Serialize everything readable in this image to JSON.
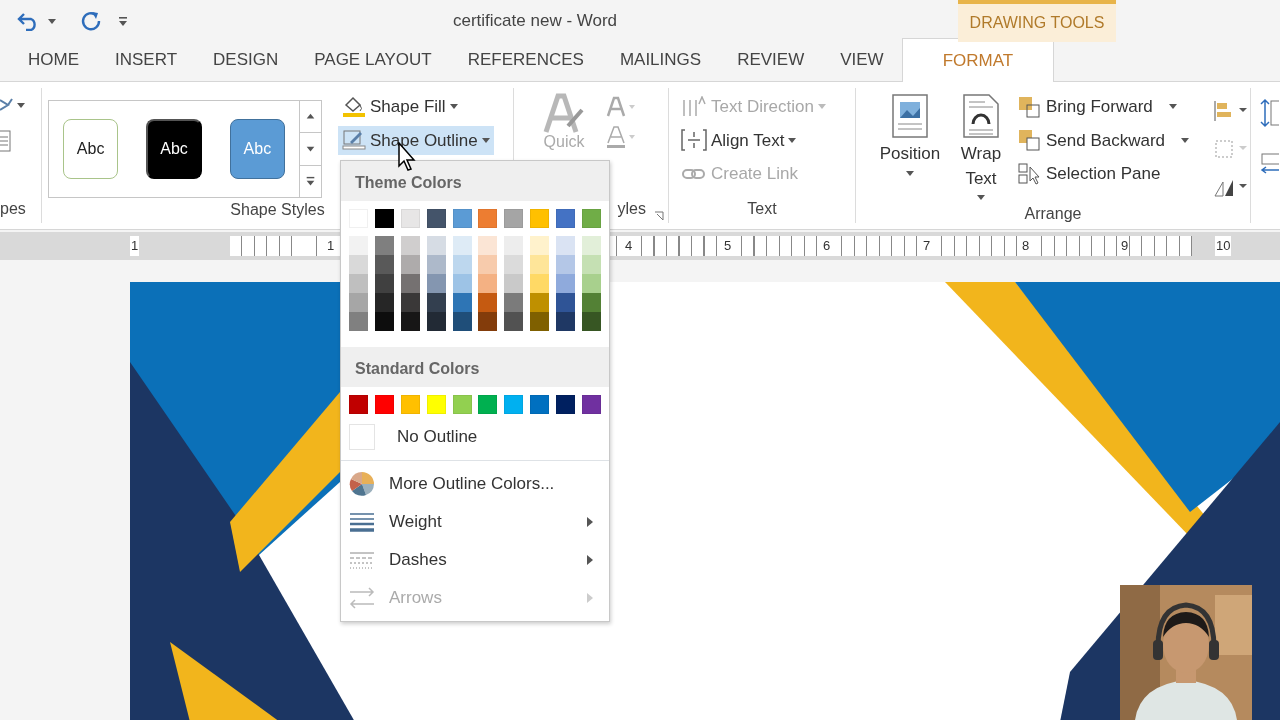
{
  "window": {
    "title": "certificate new - Word"
  },
  "context_tab_group": {
    "label": "DRAWING TOOLS"
  },
  "tabs": [
    {
      "label": "HOME",
      "selected": false
    },
    {
      "label": "INSERT",
      "selected": false
    },
    {
      "label": "DESIGN",
      "selected": false
    },
    {
      "label": "PAGE LAYOUT",
      "selected": false
    },
    {
      "label": "REFERENCES",
      "selected": false
    },
    {
      "label": "MAILINGS",
      "selected": false
    },
    {
      "label": "REVIEW",
      "selected": false
    },
    {
      "label": "VIEW",
      "selected": false
    },
    {
      "label": "FORMAT",
      "selected": true
    }
  ],
  "ribbon": {
    "shapes_group": {
      "label": "pes"
    },
    "shape_styles": {
      "label": "Shape Styles",
      "presets": [
        {
          "label": "Abc",
          "kind": "outline"
        },
        {
          "label": "Abc",
          "kind": "dark"
        },
        {
          "label": "Abc",
          "kind": "accent"
        }
      ],
      "commands": [
        {
          "label": "Shape Fill",
          "kind": "fill",
          "selected": false
        },
        {
          "label": "Shape Outline",
          "kind": "outline",
          "selected": true
        }
      ]
    },
    "wordart_styles": {
      "button_label": "Quick",
      "label": "yles"
    },
    "text_group": {
      "label": "Text",
      "commands": [
        {
          "label": "Text Direction",
          "kind": "direction",
          "disabled": true
        },
        {
          "label": "Align Text",
          "kind": "align",
          "disabled": false
        },
        {
          "label": "Create Link",
          "kind": "link",
          "disabled": true
        }
      ]
    },
    "arrange": {
      "label": "Arrange",
      "large": [
        {
          "label": "Position",
          "kind": "position"
        },
        {
          "label": "Wrap Text",
          "kind": "wrap"
        }
      ],
      "commands": [
        {
          "label": "Bring Forward",
          "kind": "forward"
        },
        {
          "label": "Send Backward",
          "kind": "backward"
        },
        {
          "label": "Selection Pane",
          "kind": "pane"
        }
      ]
    }
  },
  "ruler": {
    "labels": [
      "1",
      "1",
      "4",
      "5",
      "6",
      "7",
      "8",
      "9",
      "10"
    ]
  },
  "outline_menu": {
    "theme_heading": "Theme Colors",
    "theme_colors": [
      {
        "color": "#ffffff",
        "shades": [
          {
            "color": "#f2f2f2"
          },
          {
            "color": "#d9d9d9"
          },
          {
            "color": "#bfbfbf"
          },
          {
            "color": "#a6a6a6"
          },
          {
            "color": "#808080"
          }
        ]
      },
      {
        "color": "#000000",
        "shades": [
          {
            "color": "#7f7f7f"
          },
          {
            "color": "#595959"
          },
          {
            "color": "#404040"
          },
          {
            "color": "#262626"
          },
          {
            "color": "#0d0d0d"
          }
        ]
      },
      {
        "color": "#e7e6e6",
        "shades": [
          {
            "color": "#d0cece"
          },
          {
            "color": "#aeabab"
          },
          {
            "color": "#757171"
          },
          {
            "color": "#3a3838"
          },
          {
            "color": "#171616"
          }
        ]
      },
      {
        "color": "#44546a",
        "shades": [
          {
            "color": "#d6dce4"
          },
          {
            "color": "#adb9ca"
          },
          {
            "color": "#8496b0"
          },
          {
            "color": "#333f4f"
          },
          {
            "color": "#222a35"
          }
        ]
      },
      {
        "color": "#5b9bd5",
        "shades": [
          {
            "color": "#deebf6"
          },
          {
            "color": "#bdd7ee"
          },
          {
            "color": "#9dc3e6"
          },
          {
            "color": "#2e75b5"
          },
          {
            "color": "#1f4e79"
          }
        ]
      },
      {
        "color": "#ed7d31",
        "shades": [
          {
            "color": "#fbe5d5"
          },
          {
            "color": "#f7cbac"
          },
          {
            "color": "#f4b183"
          },
          {
            "color": "#c55a11"
          },
          {
            "color": "#833c0b"
          }
        ]
      },
      {
        "color": "#a5a5a5",
        "shades": [
          {
            "color": "#ededed"
          },
          {
            "color": "#dbdbdb"
          },
          {
            "color": "#c9c9c9"
          },
          {
            "color": "#7b7b7b"
          },
          {
            "color": "#525252"
          }
        ]
      },
      {
        "color": "#ffc000",
        "shades": [
          {
            "color": "#fff2cc"
          },
          {
            "color": "#fee599"
          },
          {
            "color": "#ffd965"
          },
          {
            "color": "#bf9000"
          },
          {
            "color": "#7f6000"
          }
        ]
      },
      {
        "color": "#4472c4",
        "shades": [
          {
            "color": "#dae3f3"
          },
          {
            "color": "#b4c7e7"
          },
          {
            "color": "#8faadc"
          },
          {
            "color": "#2f5496"
          },
          {
            "color": "#1f3864"
          }
        ]
      },
      {
        "color": "#70ad47",
        "shades": [
          {
            "color": "#e2efd9"
          },
          {
            "color": "#c5e0b3"
          },
          {
            "color": "#a8d08d"
          },
          {
            "color": "#538135"
          },
          {
            "color": "#375623"
          }
        ]
      }
    ],
    "standard_heading": "Standard Colors",
    "standard_colors": [
      {
        "color": "#c00000"
      },
      {
        "color": "#ff0000"
      },
      {
        "color": "#ffc000"
      },
      {
        "color": "#ffff00"
      },
      {
        "color": "#92d050"
      },
      {
        "color": "#00b050"
      },
      {
        "color": "#00b0f0"
      },
      {
        "color": "#0070c0"
      },
      {
        "color": "#002060"
      },
      {
        "color": "#7030a0"
      }
    ],
    "items": [
      {
        "kind": "none",
        "label": "No Outline",
        "disabled": false,
        "submenu": false
      },
      {
        "kind": "more",
        "label": "More Outline Colors...",
        "disabled": false,
        "submenu": false
      },
      {
        "kind": "weight",
        "label": "Weight",
        "disabled": false,
        "submenu": true
      },
      {
        "kind": "dashes",
        "label": "Dashes",
        "disabled": false,
        "submenu": true
      },
      {
        "kind": "arrows",
        "label": "Arrows",
        "disabled": true,
        "submenu": true
      }
    ]
  }
}
